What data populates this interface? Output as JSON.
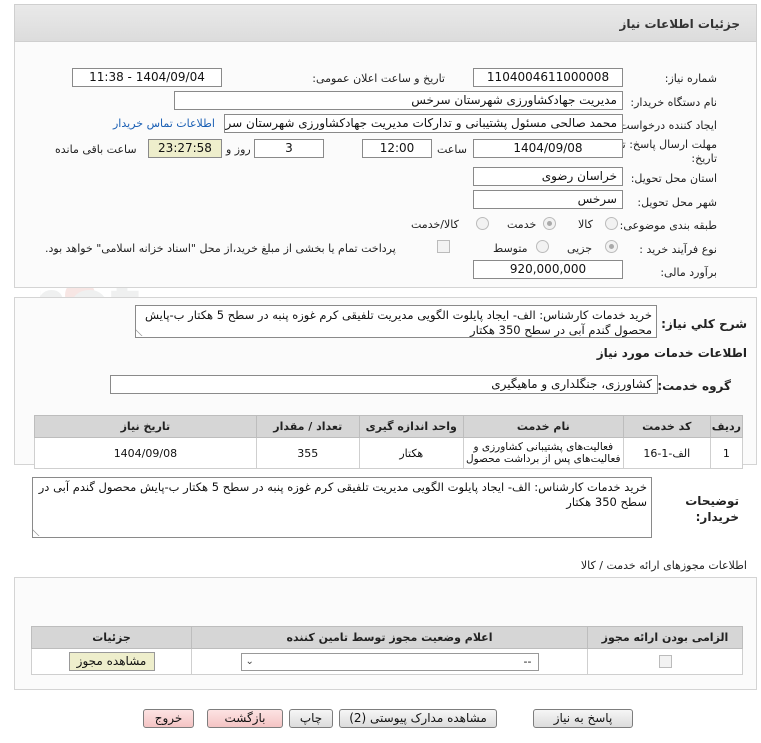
{
  "header": {
    "title": "جزئیات اطلاعات نیاز"
  },
  "form": {
    "need_number_label": "شماره نیاز:",
    "need_number": "1104004611000008",
    "announce_label": "تاریخ و ساعت اعلان عمومی:",
    "announce_value": "1404/09/04 - 11:38",
    "buyer_org_label": "نام دستگاه خریدار:",
    "buyer_org": "مدیریت جهادکشاورزی شهرستان سرخس",
    "requester_label": "ایجاد کننده درخواست:",
    "requester": "محمد صالحی مسئول پشتیبانی و تدارکات مدیریت جهادکشاورزی شهرستان سرخس",
    "contact_link": "اطلاعات تماس خریدار",
    "deadline_label_1": "مهلت ارسال پاسخ: تا",
    "deadline_label_2": "تاریخ:",
    "deadline_date": "1404/09/08",
    "time_label": "ساعت",
    "deadline_time": "12:00",
    "days_value": "3",
    "days_label": "روز و",
    "remaining_time": "23:27:58",
    "remaining_label": "ساعت باقی مانده",
    "province_label": "استان محل تحویل:",
    "province": "خراسان رضوی",
    "city_label": "شهر محل تحویل:",
    "city": "سرخس",
    "category_label": "طبقه بندی موضوعی:",
    "category_options": [
      "کالا",
      "خدمت",
      "کالا/خدمت"
    ],
    "category_selected": "خدمت",
    "process_label": "نوع فرآیند خرید :",
    "process_options": [
      "جزیی",
      "متوسط"
    ],
    "process_selected": "جزیی",
    "payment_note": "پرداخت تمام یا بخشی از مبلغ خرید،از محل \"اسناد خزانه اسلامی\" خواهد بود.",
    "estimate_label": "برآورد مالی:",
    "estimate": "920,000,000"
  },
  "summary": {
    "label": "شرح کلي نياز:",
    "text": "خرید خدمات کارشناس: الف- ایجاد پایلوت الگویی مدیریت تلفیقی کرم غوزه پنبه در سطح 5 هکتار ب-پایش محصول گندم آبی در سطح 350 هکتار"
  },
  "services": {
    "title": "اطلاعات خدمات مورد نياز",
    "group_label": "گروه خدمت:",
    "group_value": "کشاورزی، جنگلداری و ماهیگیری",
    "columns": [
      "رديف",
      "کد خدمت",
      "نام خدمت",
      "واحد اندازه گيری",
      "تعداد / مقدار",
      "تاريخ نياز"
    ],
    "rows": [
      [
        "1",
        "الف-1-16",
        "فعالیت‌های پشتیبانی کشاورزی و فعالیت‌های پس از برداشت محصول",
        "هکتار",
        "355",
        "1404/09/08"
      ]
    ]
  },
  "buyer_notes": {
    "label_1": "توضیحات",
    "label_2": "خریدار:",
    "text": "خرید خدمات کارشناس: الف- ایجاد پایلوت الگویی مدیریت تلفیقی کرم غوزه پنبه در سطح 5 هکتار ب-پایش محصول گندم آبی در سطح 350 هکتار"
  },
  "permits": {
    "title": "اطلاعات مجوزهای ارائه خدمت / کالا",
    "columns": [
      "الزامی بودن ارائه مجوز",
      "اعلام وضعیت مجوز توسط تامین کننده",
      "جزئیات"
    ],
    "select_value": "--",
    "view_button": "مشاهده مجوز"
  },
  "footer": {
    "reply": "پاسخ به نیاز",
    "docs": "مشاهده مدارک پیوستی (2)",
    "print": "چاپ",
    "back": "بازگشت",
    "exit": "خروج"
  },
  "watermark": {
    "text": "AriaTender.net"
  },
  "colors": {
    "link": "#1a5fb4",
    "highlight": "#eeeecc",
    "header_bg": "#e0e0e0",
    "table_header": "#d6d6d6"
  }
}
